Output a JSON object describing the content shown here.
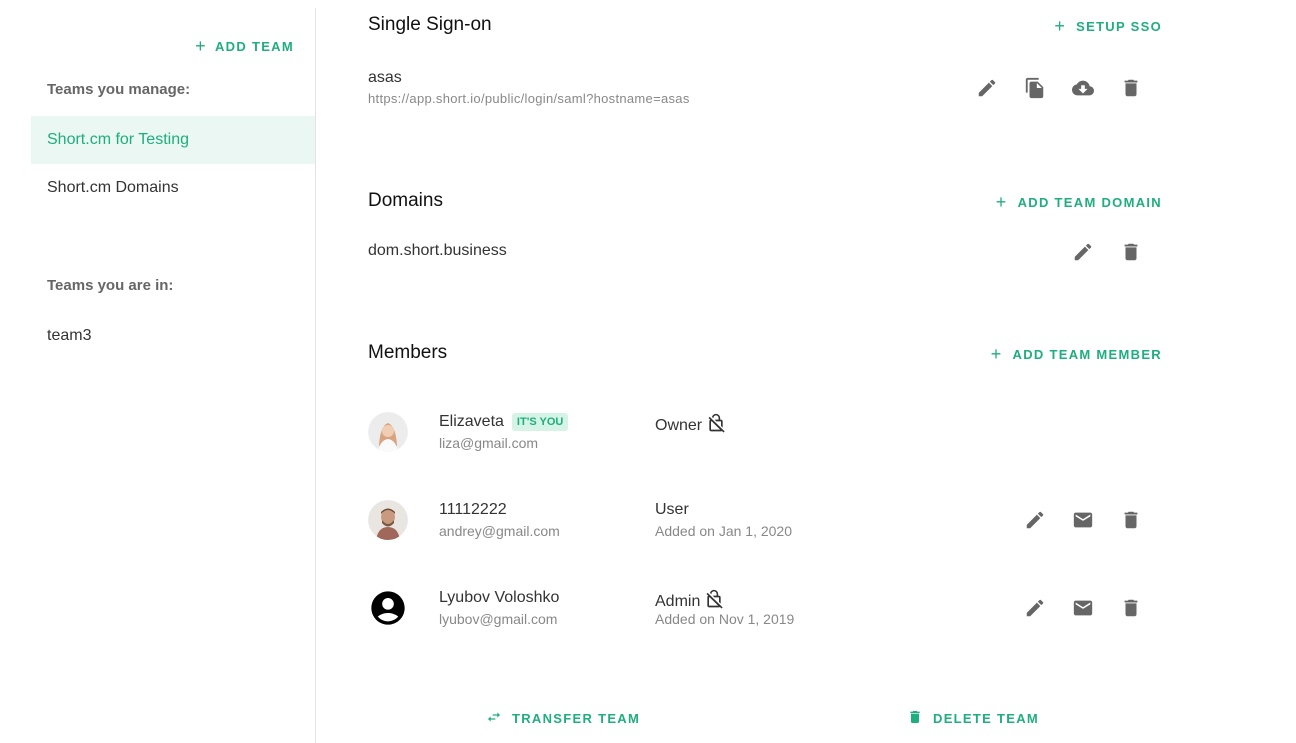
{
  "sidebar": {
    "add_team_label": "ADD TEAM",
    "manage_label": "Teams you manage:",
    "managed_teams": [
      {
        "label": "Short.cm for Testing",
        "active": true
      },
      {
        "label": "Short.cm Domains",
        "active": false
      }
    ],
    "member_label": "Teams you are in:",
    "member_teams": [
      {
        "label": "team3"
      }
    ]
  },
  "sso": {
    "title": "Single Sign-on",
    "action_label": "SETUP SSO",
    "name": "asas",
    "url": "https://app.short.io/public/login/saml?hostname=asas",
    "icons": [
      "edit-icon",
      "copy-icon",
      "cloud-download-icon",
      "delete-icon"
    ]
  },
  "domains": {
    "title": "Domains",
    "action_label": "ADD TEAM DOMAIN",
    "items": [
      {
        "name": "dom.short.business"
      }
    ]
  },
  "members": {
    "title": "Members",
    "action_label": "ADD TEAM MEMBER",
    "items": [
      {
        "name": "Elizaveta",
        "badge": "IT'S YOU",
        "email": "liza@gmail.com",
        "role": "Owner",
        "added": ""
      },
      {
        "name": "11112222",
        "badge": "",
        "email": "andrey@gmail.com",
        "role": "User",
        "added": "Added on Jan 1, 2020"
      },
      {
        "name": "Lyubov Voloshko",
        "badge": "",
        "email": "lyubov@gmail.com",
        "role": "Admin",
        "added": "Added on Nov 1, 2019"
      }
    ]
  },
  "footer": {
    "transfer_label": "TRANSFER TEAM",
    "delete_label": "DELETE TEAM"
  },
  "colors": {
    "accent": "#1fae7d",
    "active_bg": "#ebf7f2",
    "icon": "#666666"
  }
}
